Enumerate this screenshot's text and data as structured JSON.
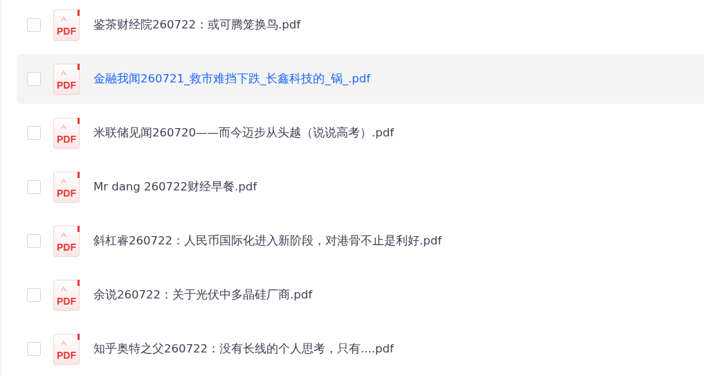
{
  "files": [
    {
      "name": "鉴茶财经院260722：或可腾笼换鸟.pdf",
      "icon_label": "PDF",
      "checked": false,
      "highlighted": false
    },
    {
      "name": "金融我闻260721_救市难挡下跌_长鑫科技的_锅_.pdf",
      "icon_label": "PDF",
      "checked": false,
      "highlighted": true
    },
    {
      "name": "米联储见闻260720——而今迈步从头越（说说高考）.pdf",
      "icon_label": "PDF",
      "checked": false,
      "highlighted": false
    },
    {
      "name": "Mr dang 260722财经早餐.pdf",
      "icon_label": "PDF",
      "checked": false,
      "highlighted": false
    },
    {
      "name": "斜杠睿260722：人民币国际化进入新阶段，对港骨不止是利好.pdf",
      "icon_label": "PDF",
      "checked": false,
      "highlighted": false
    },
    {
      "name": "余说260722：关于光伏中多晶硅厂商.pdf",
      "icon_label": "PDF",
      "checked": false,
      "highlighted": false
    },
    {
      "name": "知乎奥特之父260722：没有长线的个人思考，只有....pdf",
      "icon_label": "PDF",
      "checked": false,
      "highlighted": false
    }
  ]
}
